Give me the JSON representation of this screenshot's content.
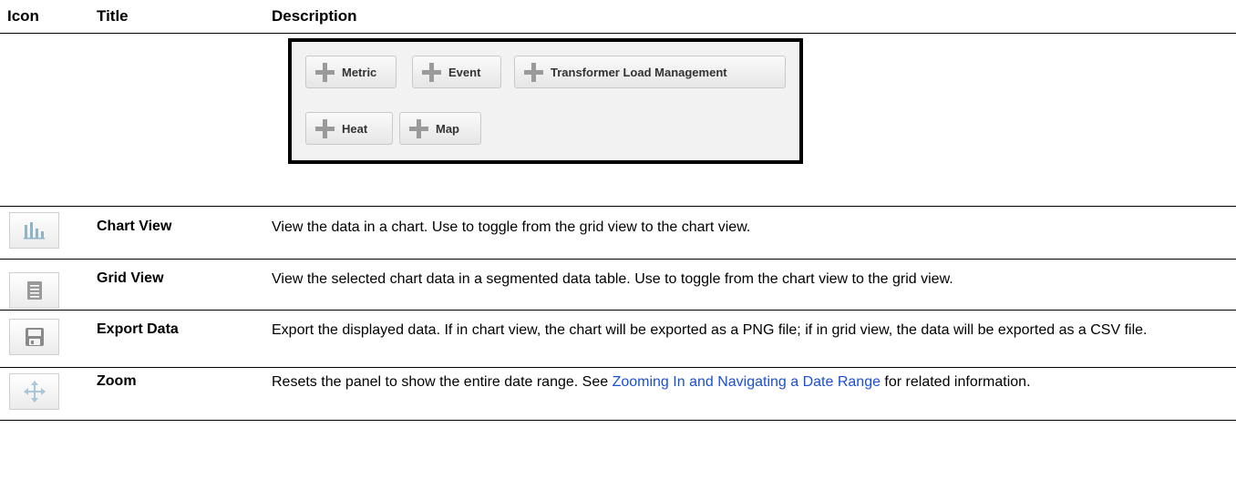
{
  "header": {
    "icon": "Icon",
    "title": "Title",
    "description": "Description"
  },
  "toolbar": {
    "buttons": [
      {
        "label": "Metric",
        "icon": "plus-icon"
      },
      {
        "label": "Event",
        "icon": "plus-icon"
      },
      {
        "label": "Transformer Load Management",
        "icon": "plus-icon"
      },
      {
        "label": "Heat",
        "icon": "plus-icon"
      },
      {
        "label": "Map",
        "icon": "plus-icon"
      }
    ]
  },
  "rows": [
    {
      "icon": "bar-chart-icon",
      "title": "Chart View",
      "description": "View the data in a chart. Use to toggle from the grid view to the chart view."
    },
    {
      "icon": "grid-list-icon",
      "title": "Grid View",
      "description": "View the selected chart data in a segmented data table. Use to toggle from the chart view to the grid view."
    },
    {
      "icon": "save-disk-icon",
      "title": "Export Data",
      "description": "Export the displayed data. If in chart view, the chart will be exported as a PNG file; if in grid view, the data will be exported as a CSV file."
    },
    {
      "icon": "move-arrows-icon",
      "title": "Zoom",
      "description_before": "Resets the panel to show the entire date range. See ",
      "link_text": "Zooming In and Navigating a Date Range",
      "description_after": " for related information."
    }
  ],
  "colors": {
    "link": "#1a4fd6",
    "icon_gray": "#9a9a9a"
  }
}
